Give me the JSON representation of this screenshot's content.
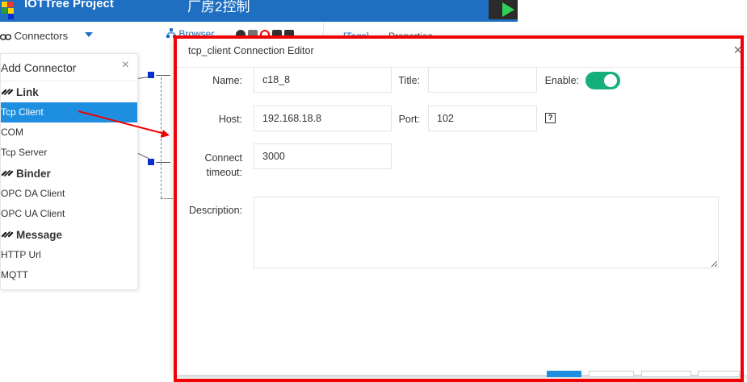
{
  "header": {
    "app_title": "IOTTree Project",
    "project_name": "厂房2控制"
  },
  "toolbar": {
    "connectors_label": "Connectors",
    "browser_label": "Browser",
    "right_tab_1": "[Tags]",
    "right_tab_2": "Properties"
  },
  "add_connector": {
    "title": "Add Connector",
    "close": "×",
    "categories": [
      {
        "label": "Link",
        "items": [
          "Tcp Client",
          "COM",
          "Tcp Server"
        ]
      },
      {
        "label": "Binder",
        "items": [
          "OPC DA Client",
          "OPC UA Client"
        ]
      },
      {
        "label": "Message",
        "items": [
          "HTTP Url",
          "MQTT"
        ]
      }
    ],
    "selected_item": "Tcp Client"
  },
  "dialog": {
    "title": "tcp_client Connection Editor",
    "close": "×",
    "name_label": "Name:",
    "name_value": "c18_8",
    "title_label": "Title:",
    "title_value": "",
    "enable_label": "Enable:",
    "enabled": true,
    "host_label": "Host:",
    "host_value": "192.168.18.8",
    "port_label": "Port:",
    "port_value": "102",
    "timeout_label_1": "Connect",
    "timeout_label_2": "timeout:",
    "timeout_value": "3000",
    "description_label": "Description:",
    "description_value": "",
    "help_icon": "?"
  },
  "colors": {
    "header_bg": "#1e6fc1",
    "selected_bg": "#1e8fe0",
    "toggle_on": "#15b07a",
    "annotation_red": "#f00002"
  }
}
